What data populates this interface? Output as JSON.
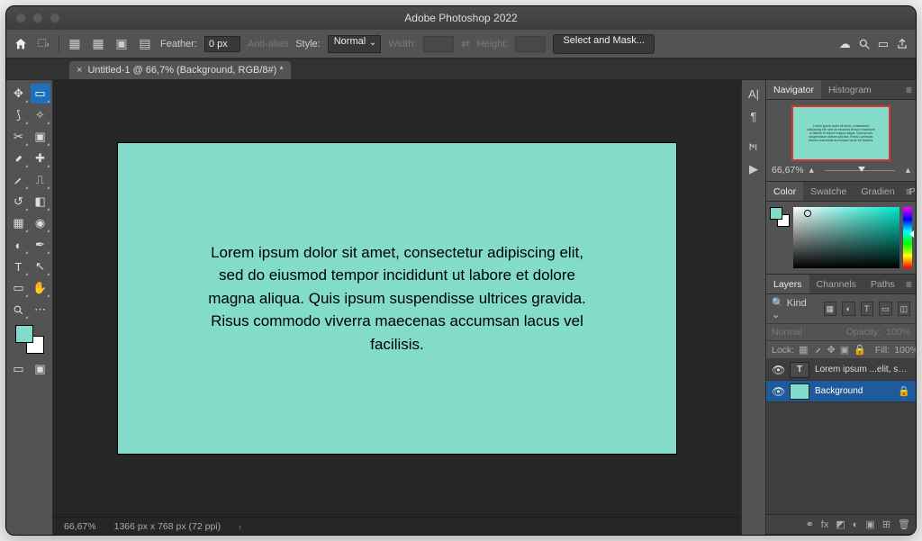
{
  "app_title": "Adobe Photoshop 2022",
  "options_bar": {
    "feather_label": "Feather:",
    "feather_value": "0 px",
    "anti_alias": "Anti-alias",
    "style_label": "Style:",
    "style_value": "Normal",
    "width_label": "Width:",
    "height_label": "Height:",
    "select_mask": "Select and Mask..."
  },
  "document_tab": {
    "title": "Untitled-1 @ 66,7% (Background, RGB/8#) *"
  },
  "canvas": {
    "text": "Lorem ipsum dolor sit amet, consectetur adipiscing elit, sed do eiusmod tempor incididunt ut labore et dolore magna aliqua. Quis ipsum suspendisse ultrices gravida. Risus commodo viverra maecenas accumsan lacus vel facilisis.",
    "bg_color": "#83dcc9"
  },
  "status": {
    "zoom": "66,67%",
    "doc_info": "1366 px x 768 px (72 ppi)"
  },
  "panels": {
    "navigator": {
      "tab1": "Navigator",
      "tab2": "Histogram",
      "zoom": "66,67%"
    },
    "color": {
      "tabs": [
        "Color",
        "Swatche",
        "Gradien",
        "Patterns"
      ]
    },
    "layers": {
      "tabs": [
        "Layers",
        "Channels",
        "Paths"
      ],
      "kind": "Kind",
      "blend": "Normal",
      "opacity_label": "Opacity:",
      "opacity_value": "100%",
      "lock_label": "Lock:",
      "fill_label": "Fill:",
      "fill_value": "100%",
      "items": [
        {
          "name": "Lorem ipsum ...elit, sed do",
          "type": "text",
          "locked": false
        },
        {
          "name": "Background",
          "type": "bg",
          "locked": true
        }
      ]
    }
  }
}
